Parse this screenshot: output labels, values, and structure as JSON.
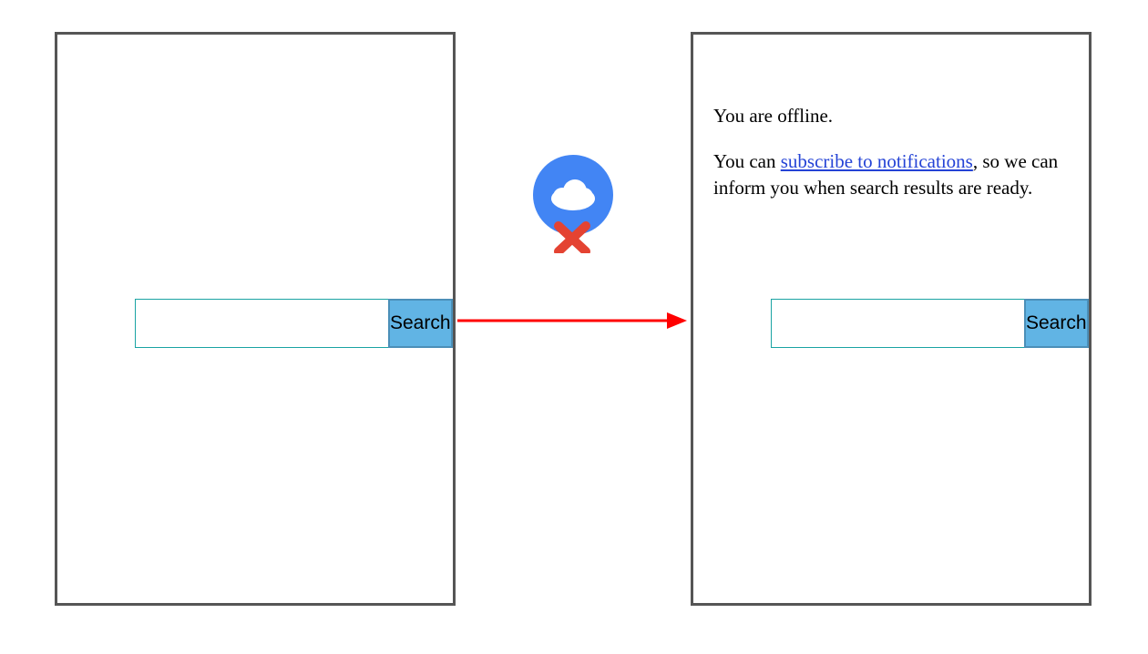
{
  "left": {
    "search_button_label": "Search",
    "search_value": ""
  },
  "right": {
    "search_button_label": "Search",
    "search_value": "",
    "offline_line1": "You are offline.",
    "offline_line2_a": "You can ",
    "offline_line2_link": "subscribe to notifications",
    "offline_line2_b": ", so we can inform you when search results are ready."
  },
  "icon": {
    "name": "cloud-offline-icon"
  },
  "colors": {
    "panel_border": "#555555",
    "button_bg": "#61b4e4",
    "button_border": "#4b8fb8",
    "input_border": "#1aa3a3",
    "link": "#2443d6",
    "arrow": "#ff0000",
    "cloud_bg": "#4285f4",
    "cloud_fg": "#ffffff",
    "x_mark": "#e44332"
  }
}
